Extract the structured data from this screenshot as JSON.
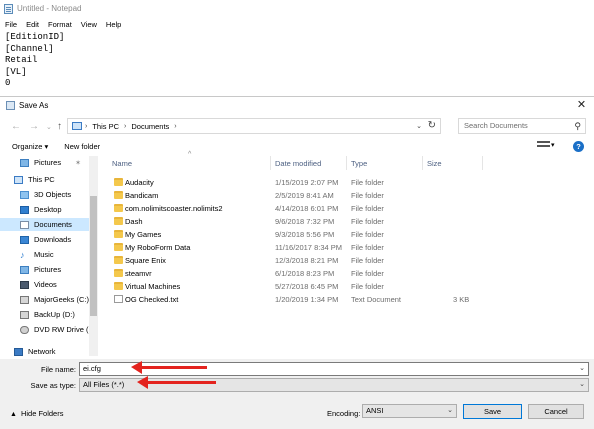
{
  "notepad": {
    "title": "Untitled - Notepad",
    "menu": [
      "File",
      "Edit",
      "Format",
      "View",
      "Help"
    ],
    "lines": [
      "[EditionID]",
      "[Channel]",
      "Retail",
      "[VL]",
      "0"
    ]
  },
  "dialog": {
    "title": "Save As",
    "breadcrumb": [
      "This PC",
      "Documents"
    ],
    "search_placeholder": "Search Documents",
    "organize_label": "Organize ▾",
    "new_folder_label": "New folder",
    "help_label": "?",
    "nav_items": [
      {
        "label": "Pictures",
        "icon": "pictures-icon",
        "pinned": true
      },
      {
        "label": "This PC",
        "icon": "this-pc-icon"
      },
      {
        "label": "3D Objects",
        "icon": "3d-objects-icon"
      },
      {
        "label": "Desktop",
        "icon": "desktop-icon"
      },
      {
        "label": "Documents",
        "icon": "documents-icon",
        "selected": true
      },
      {
        "label": "Downloads",
        "icon": "downloads-icon"
      },
      {
        "label": "Music",
        "icon": "music-icon"
      },
      {
        "label": "Pictures",
        "icon": "pictures-icon"
      },
      {
        "label": "Videos",
        "icon": "videos-icon"
      },
      {
        "label": "MajorGeeks (C:)",
        "icon": "drive-icon"
      },
      {
        "label": "BackUp (D:)",
        "icon": "drive-icon"
      },
      {
        "label": "DVD RW Drive (E",
        "icon": "dvd-drive-icon"
      },
      {
        "label": "Network",
        "icon": "network-icon"
      }
    ],
    "columns": {
      "name": "Name",
      "date": "Date modified",
      "type": "Type",
      "size": "Size"
    },
    "files": [
      {
        "name": "Audacity",
        "date": "1/15/2019 2:07 PM",
        "type": "File folder",
        "size": "",
        "kind": "folder"
      },
      {
        "name": "Bandicam",
        "date": "2/5/2019 8:41 AM",
        "type": "File folder",
        "size": "",
        "kind": "folder"
      },
      {
        "name": "com.nolimitscoaster.nolimits2",
        "date": "4/14/2018 6:01 PM",
        "type": "File folder",
        "size": "",
        "kind": "folder"
      },
      {
        "name": "Dash",
        "date": "9/6/2018 7:32 PM",
        "type": "File folder",
        "size": "",
        "kind": "folder"
      },
      {
        "name": "My Games",
        "date": "9/3/2018 5:56 PM",
        "type": "File folder",
        "size": "",
        "kind": "folder"
      },
      {
        "name": "My RoboForm Data",
        "date": "11/16/2017 8:34 PM",
        "type": "File folder",
        "size": "",
        "kind": "folder"
      },
      {
        "name": "Square Enix",
        "date": "12/3/2018 8:21 PM",
        "type": "File folder",
        "size": "",
        "kind": "folder"
      },
      {
        "name": "steamvr",
        "date": "6/1/2018 8:23 PM",
        "type": "File folder",
        "size": "",
        "kind": "folder"
      },
      {
        "name": "Virtual Machines",
        "date": "5/27/2018 6:45 PM",
        "type": "File folder",
        "size": "",
        "kind": "folder"
      },
      {
        "name": "OG Checked.txt",
        "date": "1/20/2019 1:34 PM",
        "type": "Text Document",
        "size": "3 KB",
        "kind": "text"
      }
    ],
    "file_name_label": "File name:",
    "file_name_value": "ei.cfg",
    "save_as_type_label": "Save as type:",
    "save_as_type_value": "All Files  (*.*)",
    "hide_folders_label": "Hide Folders",
    "encoding_label": "Encoding:",
    "encoding_value": "ANSI",
    "save_label": "Save",
    "cancel_label": "Cancel"
  },
  "colors": {
    "annotation_arrow": "#e3231e",
    "selection": "#cce8ff",
    "folder": "#f4c84c",
    "help_button": "#1a6fc7"
  }
}
